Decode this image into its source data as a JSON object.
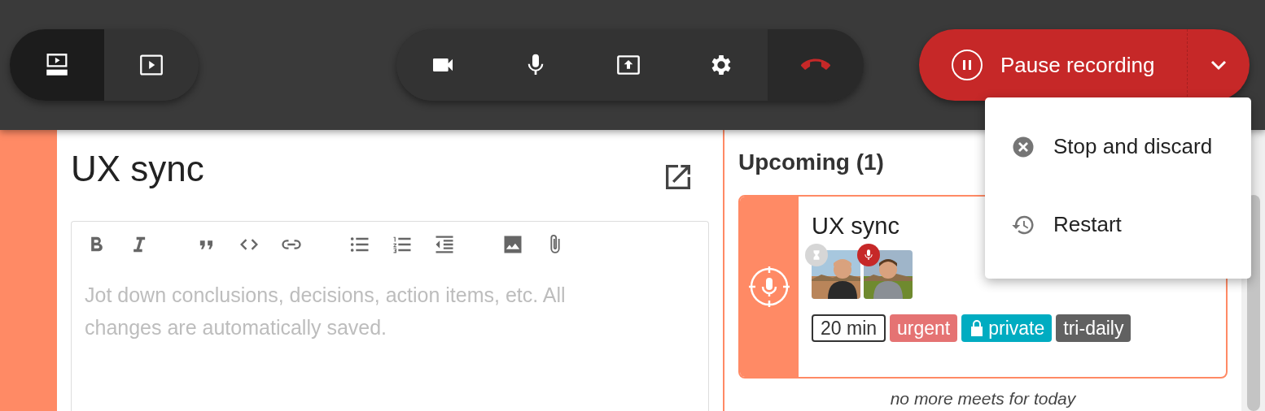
{
  "view_toggle": [
    {
      "selected": true
    },
    {
      "selected": false
    }
  ],
  "call_controls": [
    {
      "kind": "normal"
    },
    {
      "kind": "normal"
    },
    {
      "kind": "normal"
    },
    {
      "kind": "normal"
    },
    {
      "kind": "end"
    }
  ],
  "recording_button": {
    "label": "Pause recording"
  },
  "recording_menu": [
    {
      "label": "Stop and discard"
    },
    {
      "label": "Restart"
    }
  ],
  "meeting": {
    "title": "UX sync",
    "notes": {
      "placeholder": "Jot down conclusions, decisions, action items, etc. All changes are automatically saved."
    }
  },
  "upcoming": {
    "heading": "Upcoming (1)",
    "card": {
      "title": "UX sync",
      "tags": [
        {
          "label": "20 min",
          "kind": "outline",
          "color": "#333333"
        },
        {
          "label": "urgent",
          "kind": "filled",
          "color": "#e57373"
        },
        {
          "label": "private",
          "kind": "locked",
          "color": "#00acc1"
        },
        {
          "label": "tri-daily",
          "kind": "filled",
          "color": "#616161"
        }
      ]
    },
    "footer": "no more meets for today"
  }
}
